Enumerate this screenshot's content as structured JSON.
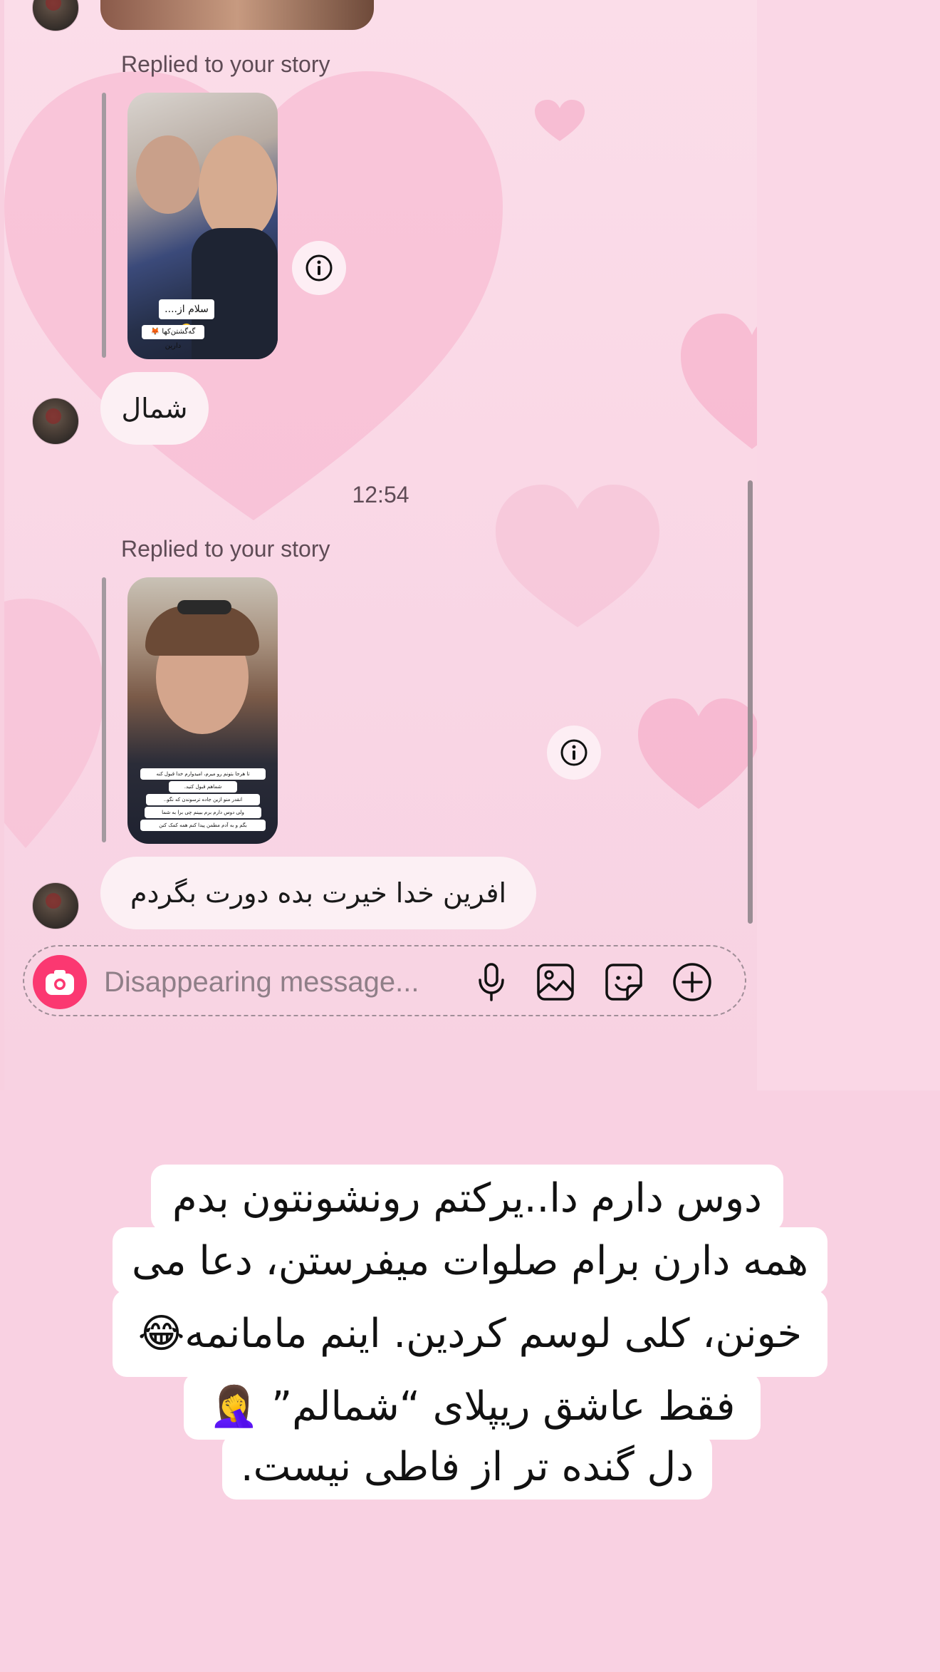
{
  "thread": {
    "story_reply_label_1": "Replied to your story",
    "story_reply_label_2": "Replied to your story",
    "story1_caption_line1": "سلام از....🥴",
    "story1_caption_line2": "گه‌گشتن‌کها 🦊 دارین",
    "message_1": "شمال",
    "timestamp": "12:54",
    "story2_caption_line1": "تا هرجا بتونم رو میرم، امیدوارم خدا قبول کنه",
    "story2_caption_line2": "شماهم قبول کنید.",
    "story2_caption_line3": "انقدر منو ازین جاده ترسوندن که نگو..",
    "story2_caption_line4": "ولی دوس دارم برم ببینم چی برا به شما",
    "story2_caption_line5": "بگم و به آدم مطمن پیدا کنم همه کمک کنن",
    "message_2": "افرین خدا خیرت بده دورت بگردم"
  },
  "composer": {
    "placeholder": "Disappearing message..."
  },
  "overlay_text": {
    "line1": "دوس دارم دا..یرکتم رونشونتون بدم",
    "line2": "همه دارن برام صلوات میفرستن، دعا می",
    "line3": "خونن، کلی لوسم کردین. اینم مامانمه😂",
    "line4": "فقط عاشق ریپلای “شمالم” 🤦‍♀️",
    "line5": "دل گنده تر از فاطی نیست."
  },
  "colors": {
    "camera_button": "#fb3871",
    "background": "#f8d0e0",
    "bubble": "#fcf0f4"
  },
  "icons": [
    "camera-icon",
    "microphone-icon",
    "gallery-icon",
    "sticker-icon",
    "plus-icon",
    "info-icon"
  ]
}
